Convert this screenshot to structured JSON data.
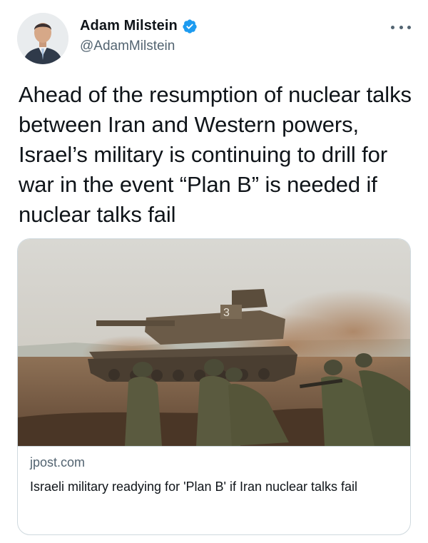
{
  "author": {
    "display_name": "Adam Milstein",
    "handle": "@AdamMilstein",
    "verified": true
  },
  "tweet": {
    "text": "Ahead of the resumption of nuclear talks between Iran and Western powers, Israel’s military is continuing to drill for war in the event “Plan B” is needed if nuclear talks fail"
  },
  "link_card": {
    "domain": "jpost.com",
    "title": "Israeli military readying for 'Plan B' if Iran nuclear talks fail",
    "tank_marking": "3"
  },
  "colors": {
    "verified_blue": "#1d9bf0",
    "secondary_text": "#536471",
    "card_border": "#cfd9de"
  },
  "icons": {
    "verified": "verified-badge-icon",
    "more": "more-horizontal-icon"
  }
}
